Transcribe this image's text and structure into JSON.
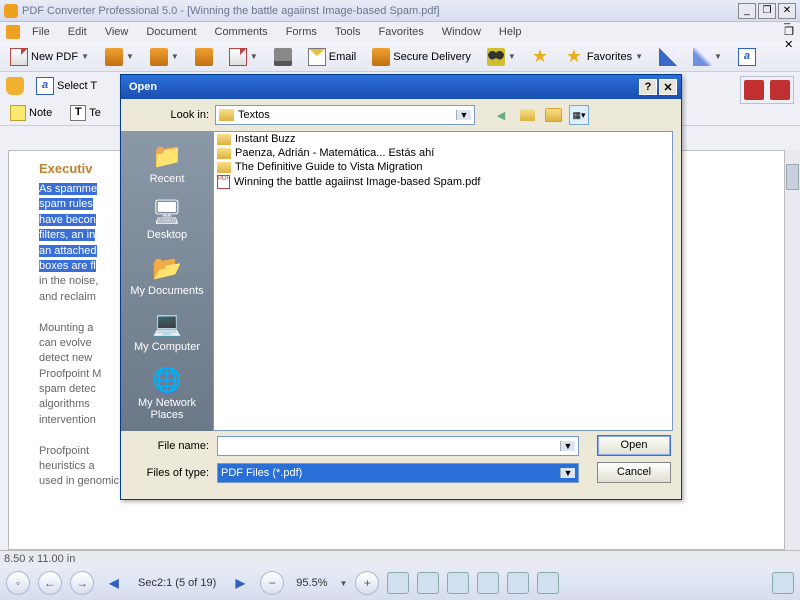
{
  "title": "PDF Converter Professional 5.0 - [Winning the battle agaiinst Image-based Spam.pdf]",
  "menu": [
    "File",
    "Edit",
    "View",
    "Document",
    "Comments",
    "Forms",
    "Tools",
    "Favorites",
    "Window",
    "Help"
  ],
  "tb1": {
    "newpdf": "New PDF",
    "email": "Email",
    "secure": "Secure Delivery",
    "favorites": "Favorites"
  },
  "tb2": {
    "select": "Select T"
  },
  "tb3": {
    "note": "Note",
    "text": "Te"
  },
  "status": {
    "pagesize": "8.50 x 11.00 in"
  },
  "bottom": {
    "sec": "Sec2:1 (5 of 19)",
    "zoom": "95.5%"
  },
  "doc": {
    "heading": "Executiv",
    "hl": [
      "As spamme",
      "spam rules",
      "have becon",
      "filters, an in",
      "an attached",
      "boxes are fl"
    ],
    "p1a": "in the noise,",
    "p1b": "and reclaim",
    "p2": "Mounting a\ncan evolve\ndetect new\nProofpoint M\nspam detec\nalgorithms\nintervention",
    "p3": "Proofpoint\nheuristics a\nused in genomic sequence analysis) and proprietary image analysis methods. The Proofpoint"
  },
  "dialog": {
    "title": "Open",
    "lookin_label": "Look in:",
    "lookin_value": "Textos",
    "places": [
      "Recent",
      "Desktop",
      "My Documents",
      "My Computer",
      "My Network Places"
    ],
    "files": [
      {
        "type": "folder",
        "name": "Instant Buzz"
      },
      {
        "type": "folder",
        "name": "Paenza, Adrián - Matemática... Estás ahí"
      },
      {
        "type": "folder",
        "name": "The Definitive Guide to Vista Migration"
      },
      {
        "type": "pdf",
        "name": "Winning the battle agaiinst Image-based Spam.pdf"
      }
    ],
    "filename_label": "File name:",
    "filename_value": "",
    "filetype_label": "Files of type:",
    "filetype_value": "PDF Files (*.pdf)",
    "open_btn": "Open",
    "cancel_btn": "Cancel"
  }
}
